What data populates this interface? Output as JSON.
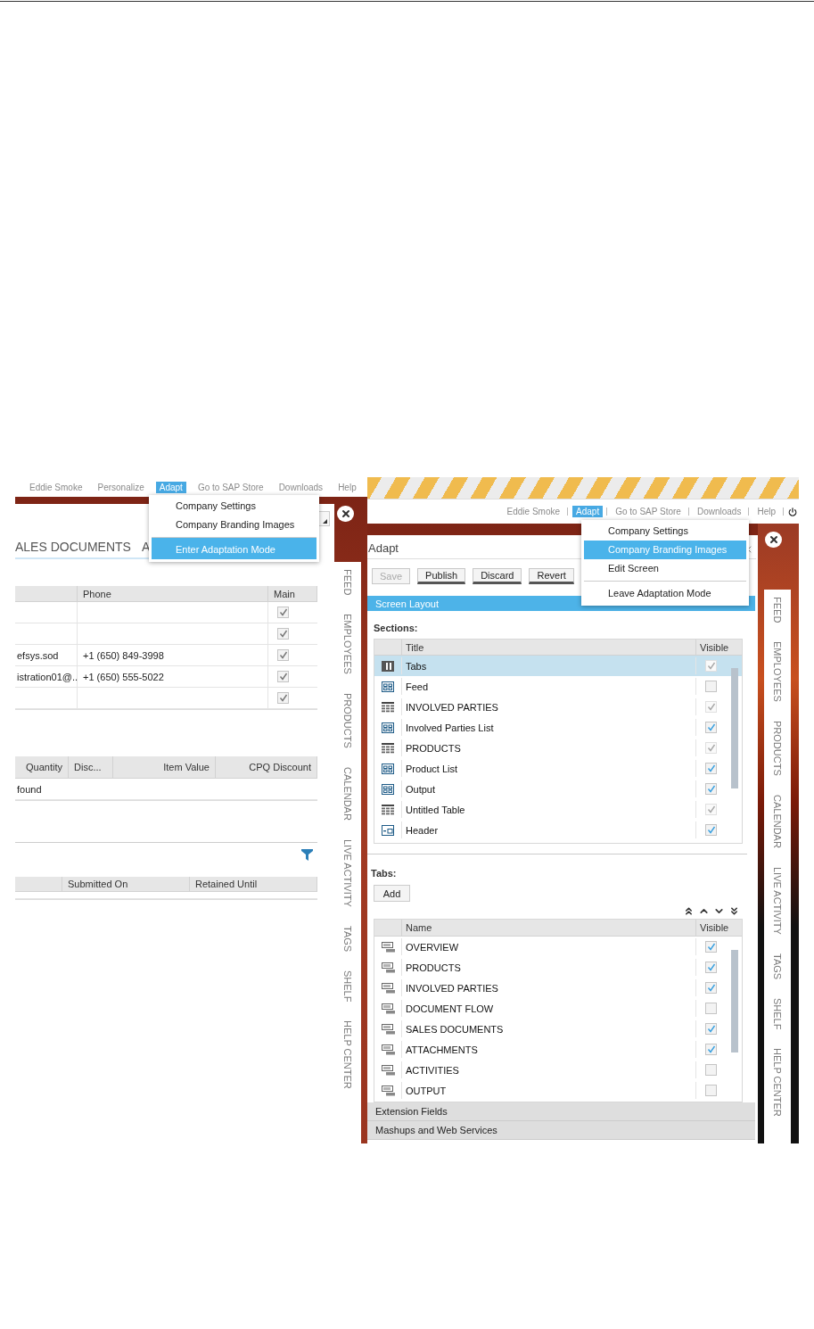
{
  "left_screen": {
    "top_links": [
      {
        "label": "Eddie Smoke",
        "selected": false
      },
      {
        "label": "Personalize",
        "selected": false
      },
      {
        "label": "Adapt",
        "selected": true
      },
      {
        "label": "Go to SAP Store",
        "selected": false
      },
      {
        "label": "Downloads",
        "selected": false
      },
      {
        "label": "Help",
        "selected": false
      }
    ],
    "menu": [
      {
        "label": "Company Settings",
        "selected": false,
        "divider_before": false
      },
      {
        "label": "Company Branding Images",
        "selected": false,
        "divider_before": false
      },
      {
        "label": "Enter Adaptation Mode",
        "selected": true,
        "divider_before": true
      }
    ],
    "page_tabs": [
      "ALES DOCUMENTS",
      "A"
    ],
    "contacts_table": {
      "columns": [
        "Phone",
        "Main"
      ],
      "rows": [
        {
          "checked": true
        },
        {
          "checked": true
        },
        {
          "column_1": "efsys.sod",
          "phone": "+1 (650) 849-3998",
          "checked": true
        },
        {
          "column_1": "istration01@..",
          "phone": "+1 (650) 555-5022",
          "checked": true
        },
        {
          "checked": true
        }
      ]
    },
    "items_table": {
      "columns": [
        "Quantity",
        "Disc...",
        "Item Value",
        "CPQ Discount"
      ],
      "empty_text": "found"
    },
    "documents_table": {
      "columns": [
        "Submitted On",
        "Retained Until"
      ]
    },
    "sidebar": [
      "FEED",
      "EMPLOYEES",
      "PRODUCTS",
      "CALENDAR",
      "LIVE ACTIVITY",
      "TAGS",
      "SHELF",
      "HELP CENTER"
    ]
  },
  "right_screen": {
    "top_links": [
      {
        "label": "Eddie Smoke",
        "selected": false
      },
      {
        "label": "Adapt",
        "selected": true
      },
      {
        "label": "Go to SAP Store",
        "selected": false
      },
      {
        "label": "Downloads",
        "selected": false
      },
      {
        "label": "Help",
        "selected": false
      }
    ],
    "menu": [
      {
        "label": "Company Settings",
        "selected": false,
        "divider_before": false
      },
      {
        "label": "Company Branding Images",
        "selected": true,
        "divider_before": false
      },
      {
        "label": "Edit Screen",
        "selected": false,
        "divider_before": false
      },
      {
        "label": "Leave Adaptation Mode",
        "selected": false,
        "divider_before": true
      }
    ],
    "dialog": {
      "title": "Adapt",
      "buttons": [
        {
          "label": "Save",
          "disabled": true
        },
        {
          "label": "Publish",
          "disabled": false
        },
        {
          "label": "Discard",
          "disabled": false
        },
        {
          "label": "Revert",
          "disabled": false
        }
      ],
      "section_bar": "Screen Layout",
      "sections_label": "Sections:",
      "sections_columns": [
        "Title",
        "Visible"
      ],
      "sections": [
        {
          "kind": "tabs",
          "title": "Tabs",
          "selected": true,
          "checked": true,
          "disabled": true
        },
        {
          "kind": "form",
          "title": "Feed",
          "selected": false,
          "checked": false,
          "disabled": false
        },
        {
          "kind": "table",
          "title": "INVOLVED PARTIES",
          "selected": false,
          "checked": true,
          "disabled": true
        },
        {
          "kind": "form",
          "title": "Involved Parties List",
          "selected": false,
          "checked": true,
          "disabled": false
        },
        {
          "kind": "table",
          "title": "PRODUCTS",
          "selected": false,
          "checked": true,
          "disabled": true
        },
        {
          "kind": "form",
          "title": "Product List",
          "selected": false,
          "checked": true,
          "disabled": false
        },
        {
          "kind": "form",
          "title": "Output",
          "selected": false,
          "checked": true,
          "disabled": false
        },
        {
          "kind": "table",
          "title": "Untitled Table",
          "selected": false,
          "checked": true,
          "disabled": true
        },
        {
          "kind": "header",
          "title": "Header",
          "selected": false,
          "checked": true,
          "disabled": false
        }
      ],
      "tabs_label": "Tabs:",
      "add_button": "Add",
      "tabs_columns": [
        "Name",
        "Visible"
      ],
      "tabs": [
        {
          "name": "OVERVIEW",
          "checked": true
        },
        {
          "name": "PRODUCTS",
          "checked": true
        },
        {
          "name": "INVOLVED PARTIES",
          "checked": true
        },
        {
          "name": "DOCUMENT FLOW",
          "checked": false
        },
        {
          "name": "SALES DOCUMENTS",
          "checked": true
        },
        {
          "name": "ATTACHMENTS",
          "checked": true
        },
        {
          "name": "ACTIVITIES",
          "checked": false
        },
        {
          "name": "OUTPUT",
          "checked": false
        }
      ],
      "collapsed_sections": [
        "Extension Fields",
        "Mashups and Web Services"
      ]
    },
    "sidebar": [
      "FEED",
      "EMPLOYEES",
      "PRODUCTS",
      "CALENDAR",
      "LIVE ACTIVITY",
      "TAGS",
      "SHELF",
      "HELP CENTER"
    ]
  }
}
